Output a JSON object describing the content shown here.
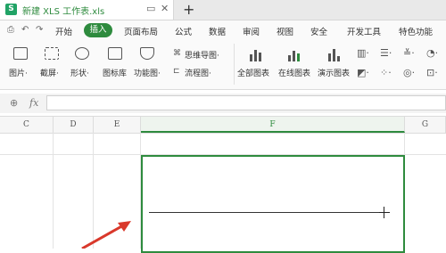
{
  "tabs": {
    "doc_title": "新建 XLS 工作表.xls",
    "doc_icon": "S",
    "add": "+"
  },
  "menu": {
    "start": "开始",
    "insert": "插入",
    "page_layout": "页面布局",
    "formula": "公式",
    "data": "数据",
    "review": "审阅",
    "view": "视图",
    "security": "安全",
    "dev_tools": "开发工具",
    "special": "特色功能"
  },
  "ribbon": {
    "picture": "图片·",
    "screenshot": "截屏·",
    "shape": "形状·",
    "icon_lib": "图标库",
    "function_chart": "功能图·",
    "mind_map": "思维导图·",
    "flowchart": "流程图·",
    "all_charts": "全部图表",
    "online_charts": "在线图表",
    "demo_charts": "演示图表"
  },
  "formula_bar": {
    "fx": "fx",
    "value": ""
  },
  "columns": [
    "C",
    "D",
    "E",
    "F",
    "G"
  ],
  "colors": {
    "accent": "#2e8b3e",
    "arrow": "#d9382b"
  }
}
